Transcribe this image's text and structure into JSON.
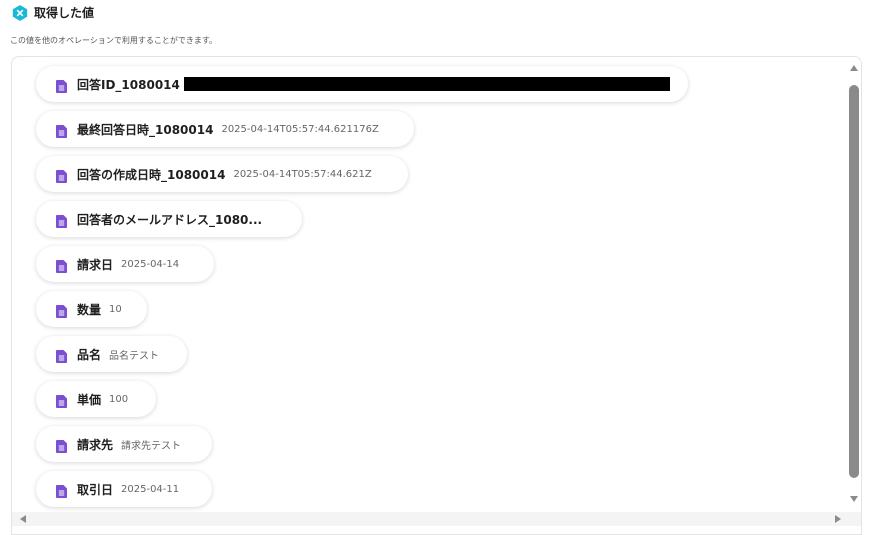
{
  "header": {
    "title": "取得した値",
    "subtitle": "この値を他のオペレーションで利用することができます。",
    "icon": "x-variable-icon"
  },
  "colors": {
    "accent": "#1ab8d8",
    "doc_icon": "#7b4fd1",
    "scrollbar": "#8a8a8a"
  },
  "fields": [
    {
      "label": "回答ID_1080014",
      "value": "",
      "redacted": true
    },
    {
      "label": "最終回答日時_1080014",
      "value": "2025-04-14T05:57:44.621176Z"
    },
    {
      "label": "回答の作成日時_1080014",
      "value": "2025-04-14T05:57:44.621Z"
    },
    {
      "label": "回答者のメールアドレス_1080...",
      "value": ""
    },
    {
      "label": "請求日",
      "value": "2025-04-14"
    },
    {
      "label": "数量",
      "value": "10"
    },
    {
      "label": "品名",
      "value": "品名テスト"
    },
    {
      "label": "単価",
      "value": "100"
    },
    {
      "label": "請求先",
      "value": "請求先テスト"
    },
    {
      "label": "取引日",
      "value": "2025-04-11"
    }
  ]
}
